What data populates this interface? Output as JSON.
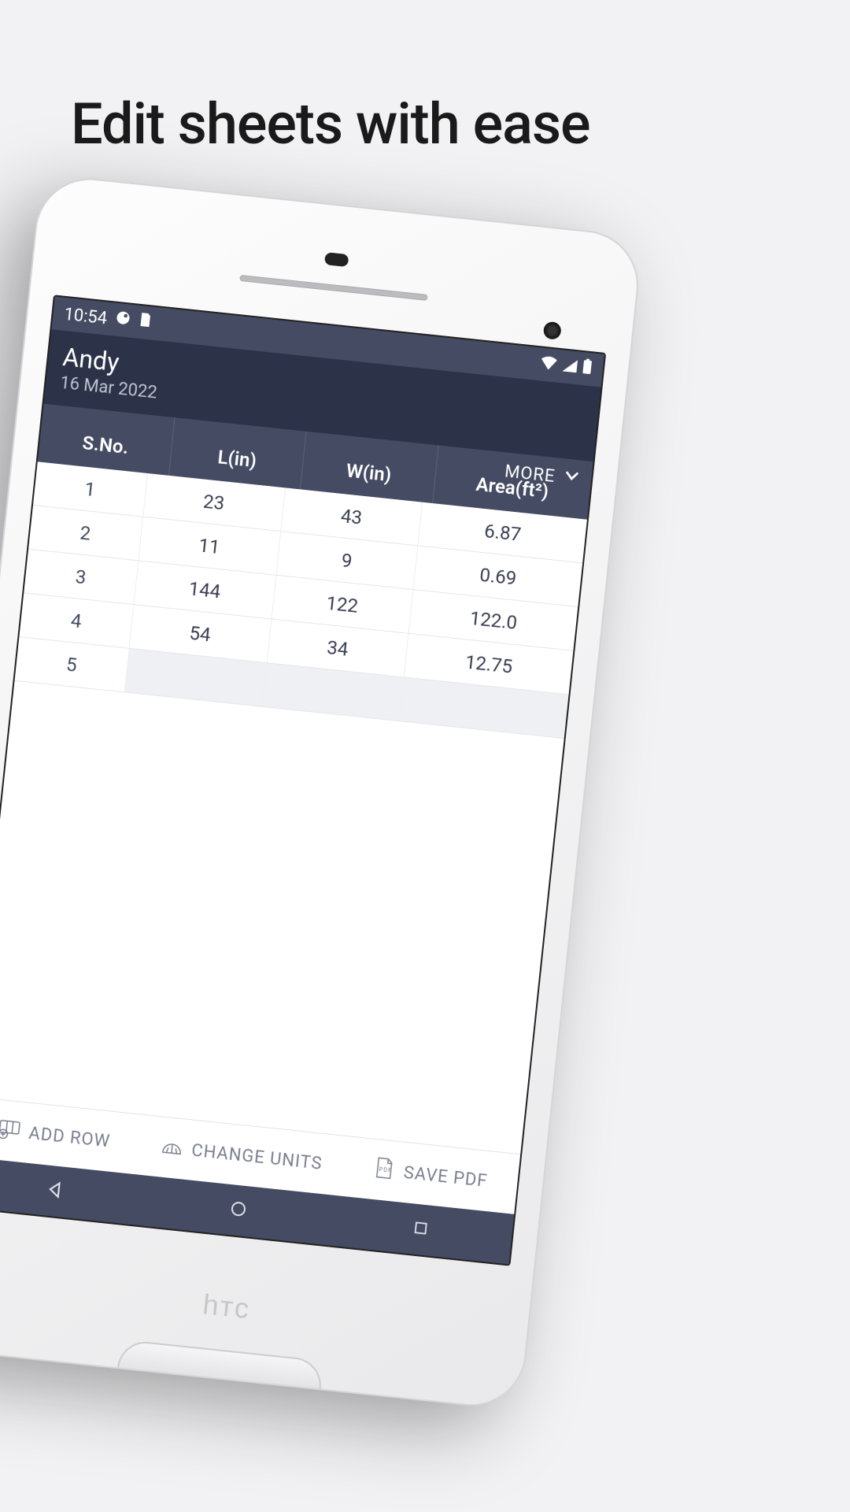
{
  "promo": {
    "title": "Edit sheets with ease"
  },
  "status": {
    "time": "10:54"
  },
  "header": {
    "name": "Andy",
    "date": "16 Mar 2022"
  },
  "more_label": "MORE",
  "columns": {
    "sno": "S.No.",
    "l": "L(in)",
    "w": "W(in)",
    "area": "Area(ft²)"
  },
  "rows": [
    {
      "sno": "1",
      "l": "23",
      "w": "43",
      "area": "6.87"
    },
    {
      "sno": "2",
      "l": "11",
      "w": "9",
      "area": "0.69"
    },
    {
      "sno": "3",
      "l": "144",
      "w": "122",
      "area": "122.0"
    },
    {
      "sno": "4",
      "l": "54",
      "w": "34",
      "area": "12.75"
    },
    {
      "sno": "5",
      "l": "",
      "w": "",
      "area": ""
    }
  ],
  "actions": {
    "add_row": "ADD ROW",
    "change_units": "CHANGE UNITS",
    "save_pdf": "SAVE PDF"
  },
  "phone_brand": "hтc"
}
